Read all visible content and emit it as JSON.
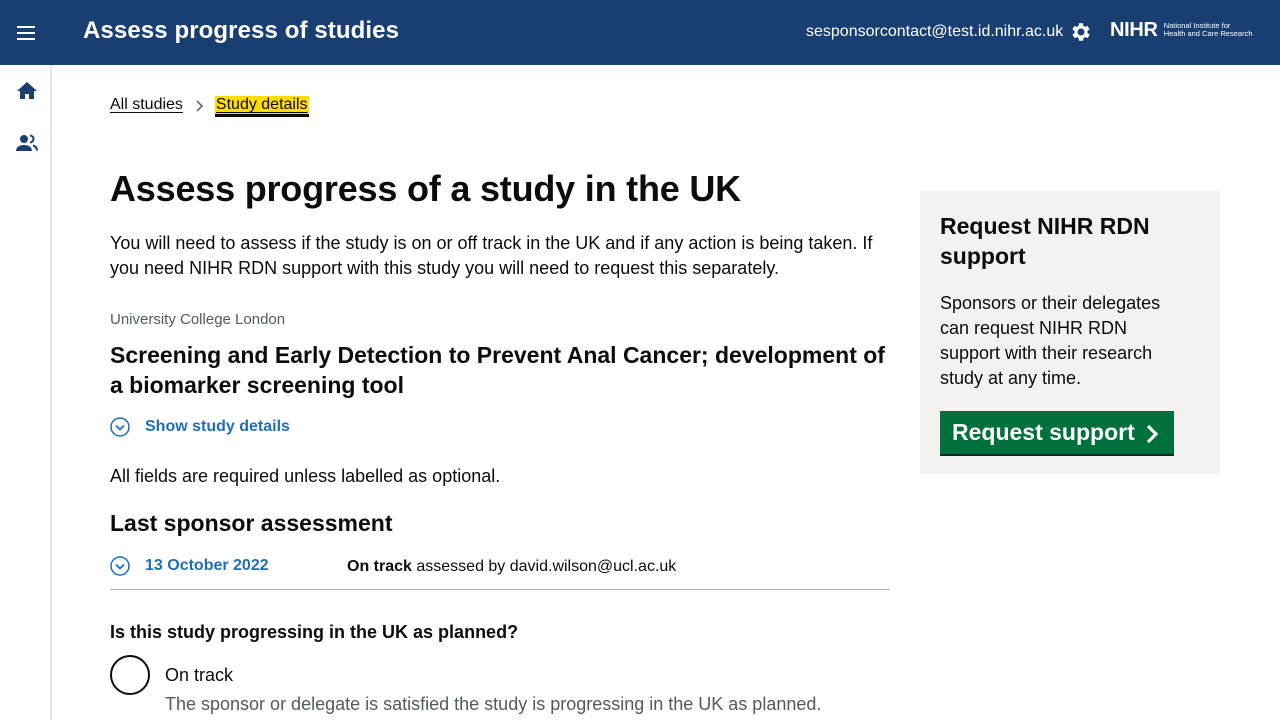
{
  "header": {
    "app_title": "Assess progress of studies",
    "user_email": "sesponsorcontact@test.id.nihr.ac.uk",
    "logo_text": "NIHR",
    "logo_subtext": "National Institute for Health and Care Research",
    "menu_icon": "hamburger-menu-icon",
    "settings_icon": "gear-icon"
  },
  "sidebar": {
    "items": [
      {
        "icon": "home-icon"
      },
      {
        "icon": "users-icon"
      }
    ]
  },
  "breadcrumb": {
    "items": [
      "All studies",
      "Study details"
    ]
  },
  "main": {
    "page_title": "Assess progress of a study in the UK",
    "intro": "You will need to assess if the study is on or off track in the UK and if any action is being taken. If you need NIHR RDN support with this study you will need to request this separately.",
    "organisation": "University College London",
    "study_title": "Screening and Early Detection to Prevent Anal Cancer; development of a biomarker screening tool",
    "show_details_label": "Show study details",
    "required_note": "All fields are required unless labelled as optional.",
    "last_assessment": {
      "heading": "Last sponsor assessment",
      "date": "13 October 2022",
      "status": "On track",
      "assessed_by_text": " assessed by david.wilson@ucl.ac.uk"
    },
    "question": {
      "label": "Is this study progressing in the UK as planned?",
      "options": [
        {
          "label": "On track",
          "hint": "The sponsor or delegate is satisfied the study is progressing in the UK as planned."
        }
      ]
    }
  },
  "panel": {
    "title": "Request NIHR RDN support",
    "text": "Sponsors or their delegates can request NIHR RDN support with their research study at any time.",
    "button_label": "Request support"
  },
  "colors": {
    "header_bg": "#193e72",
    "link_blue": "#1d70b8",
    "focus_yellow": "#ffdd00",
    "button_green": "#00703c",
    "panel_bg": "#f3f2f1"
  }
}
